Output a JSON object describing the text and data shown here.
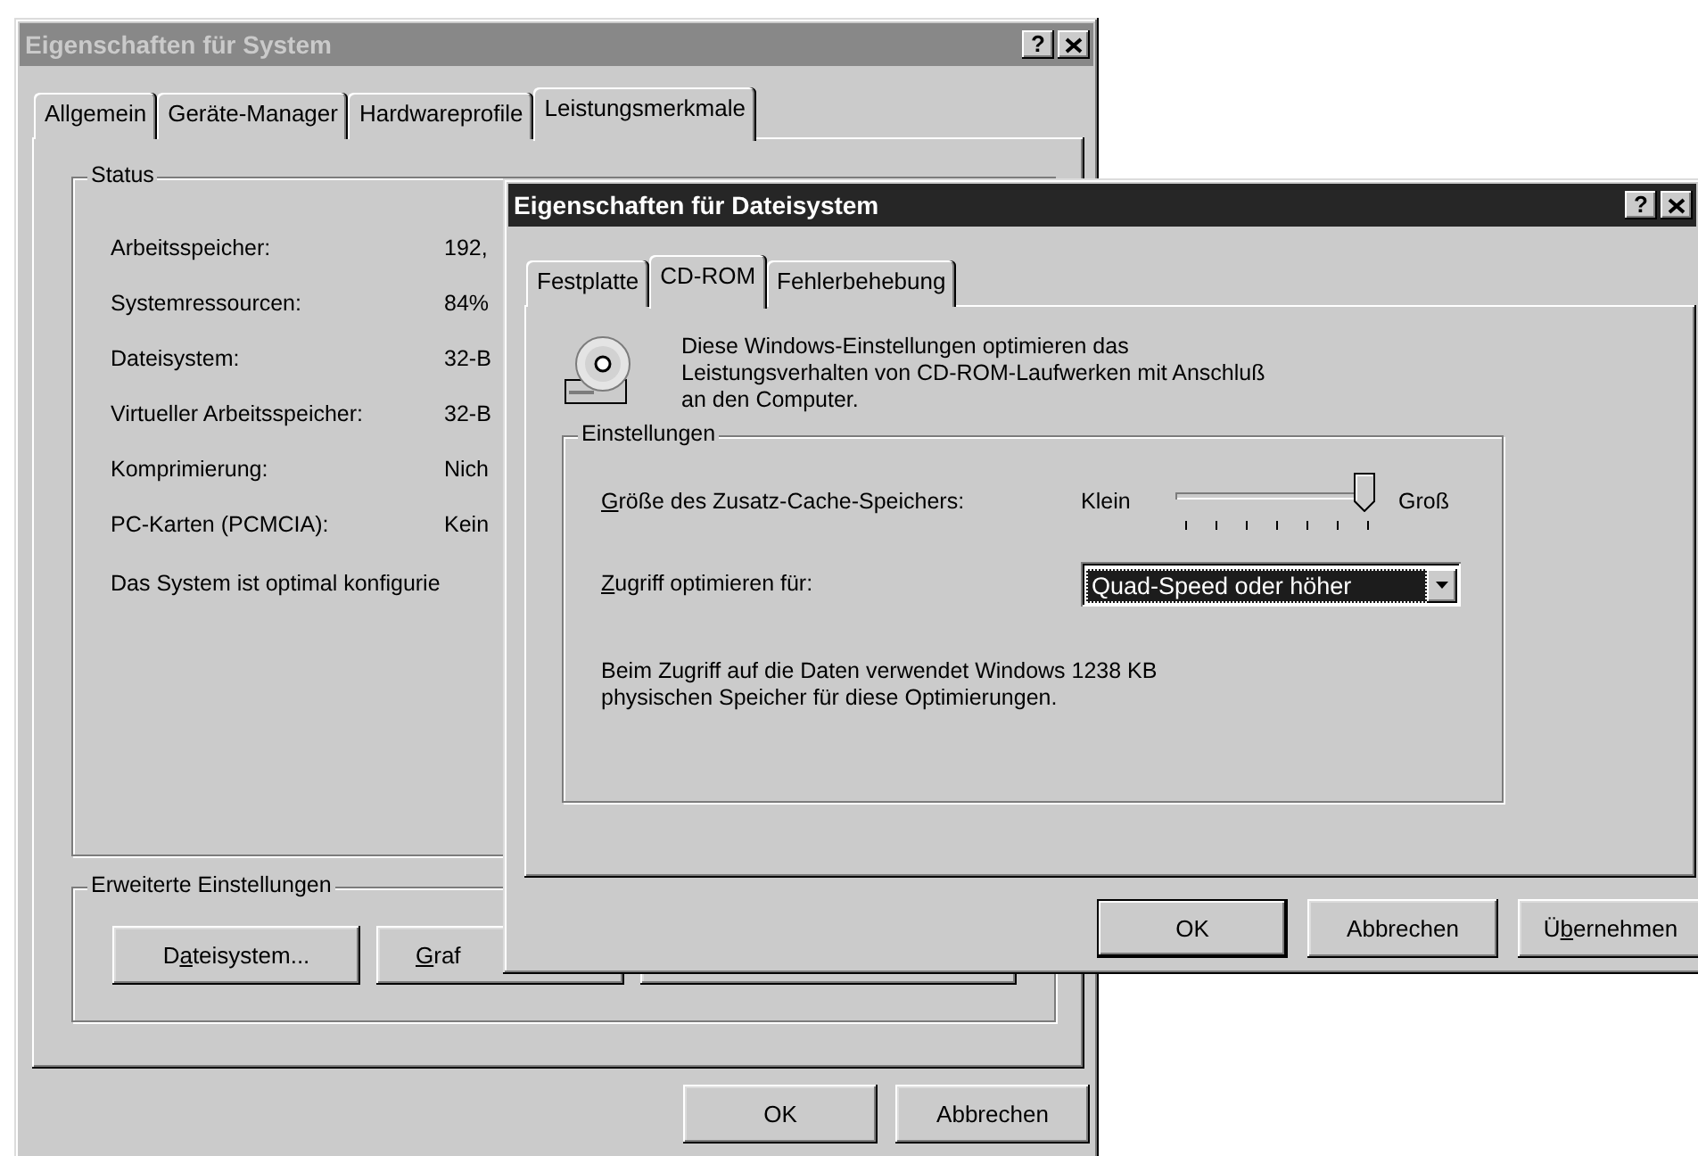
{
  "system_window": {
    "title": "Eigenschaften für System",
    "active": false,
    "help_button": "?",
    "tabs": [
      {
        "label": "Allgemein",
        "selected": false
      },
      {
        "label": "Geräte-Manager",
        "selected": false
      },
      {
        "label": "Hardwareprofile",
        "selected": false
      },
      {
        "label": "Leistungsmerkmale",
        "selected": true
      }
    ],
    "status_group": {
      "label": "Status",
      "rows": [
        {
          "label": "Arbeitsspeicher:",
          "value": "192,"
        },
        {
          "label": "Systemressourcen:",
          "value": "84%"
        },
        {
          "label": "Dateisystem:",
          "value": "32-B"
        },
        {
          "label": "Virtueller Arbeitsspeicher:",
          "value": "32-B"
        },
        {
          "label": "Komprimierung:",
          "value": "Nich"
        },
        {
          "label": "PC-Karten (PCMCIA):",
          "value": "Kein"
        }
      ],
      "message": "Das System ist optimal konfigurie"
    },
    "advanced_group": {
      "label": "Erweiterte Einstellungen",
      "buttons": [
        {
          "kind": "labeled",
          "before": "D",
          "key": "a",
          "after": "teisystem..."
        },
        {
          "kind": "labeled",
          "key": "G",
          "after": "raf"
        },
        {
          "kind": "covered"
        }
      ]
    },
    "buttons": [
      {
        "after": "OK"
      },
      {
        "after": "Abbrechen"
      }
    ]
  },
  "filesystem_window": {
    "title": "Eigenschaften für Dateisystem",
    "active": true,
    "help_button": "?",
    "tabs": [
      {
        "label": "Festplatte",
        "selected": false
      },
      {
        "label": "CD-ROM",
        "selected": true
      },
      {
        "label": "Fehlerbehebung",
        "selected": false
      }
    ],
    "description": "Diese Windows-Einstellungen optimieren das\nLeistungsverhalten von CD-ROM-Laufwerken mit Anschluß\nan den Computer.",
    "settings_group": {
      "label": "Einstellungen",
      "cache": {
        "label": {
          "key": "G",
          "after": "röße des Zusatz-Cache-Speichers:"
        },
        "min_label": "Klein",
        "max_label": "Groß",
        "level": 1
      },
      "access": {
        "label": {
          "key": "Z",
          "after": "ugriff optimieren für:"
        },
        "value": "Quad-Speed oder höher",
        "focused": true
      },
      "info": "Beim Zugriff auf die Daten verwendet Windows 1238 KB\nphysischen Speicher für diese Optimierungen."
    },
    "buttons": [
      {
        "after": "OK"
      },
      {
        "after": "Abbrechen"
      },
      {
        "before": "Ü",
        "key": "b",
        "after": "ernehmen"
      }
    ]
  }
}
